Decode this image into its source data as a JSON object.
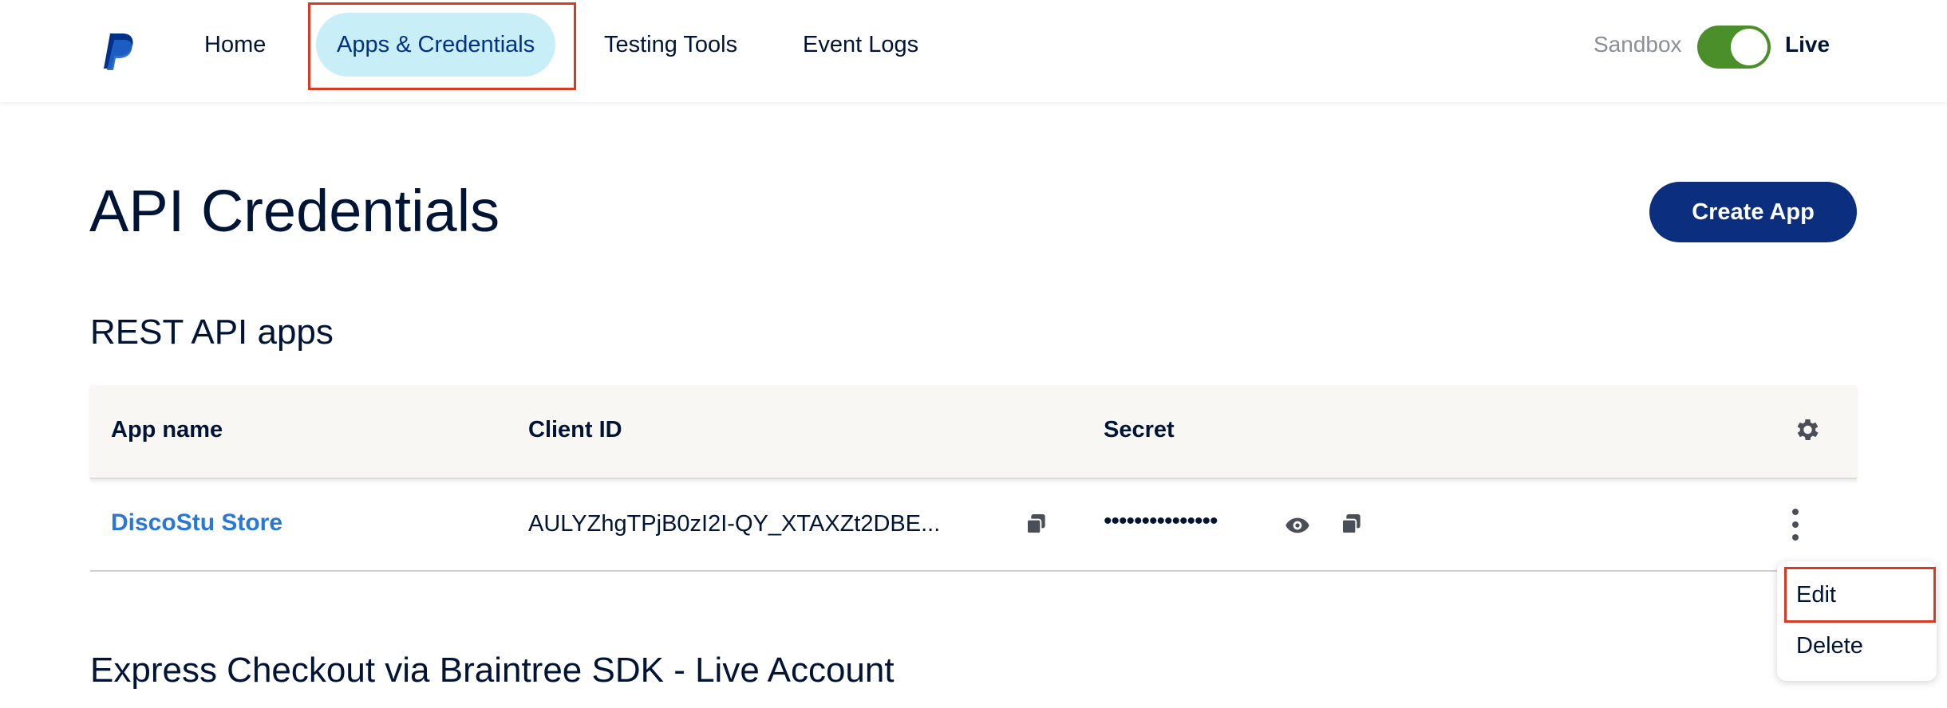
{
  "nav": {
    "items": [
      {
        "label": "Home"
      },
      {
        "label": "Apps & Credentials",
        "active": true
      },
      {
        "label": "Testing Tools"
      },
      {
        "label": "Event Logs"
      }
    ],
    "mode_toggle": {
      "left_label": "Sandbox",
      "right_label": "Live",
      "state": "Live"
    }
  },
  "page": {
    "title": "API Credentials",
    "create_button": "Create App"
  },
  "rest_apps": {
    "section_title": "REST API apps",
    "columns": [
      "App name",
      "Client ID",
      "Secret"
    ],
    "rows": [
      {
        "app_name": "DiscoStu Store",
        "client_id": "AULYZhgTPjB0zI2I-QY_XTAXZt2DBE...",
        "secret_masked": "•••••••••••••••"
      }
    ],
    "row_menu": {
      "items": [
        "Edit",
        "Delete"
      ]
    }
  },
  "express_checkout": {
    "section_title": "Express Checkout via Braintree SDK - Live Account"
  },
  "colors": {
    "primary_navy": "#0b2f7e",
    "text": "#001435",
    "link_blue": "#2a78d6",
    "active_tab_bg": "#c8eef8",
    "toggle_green": "#4a8f2a",
    "highlight_red": "#d93a24"
  }
}
